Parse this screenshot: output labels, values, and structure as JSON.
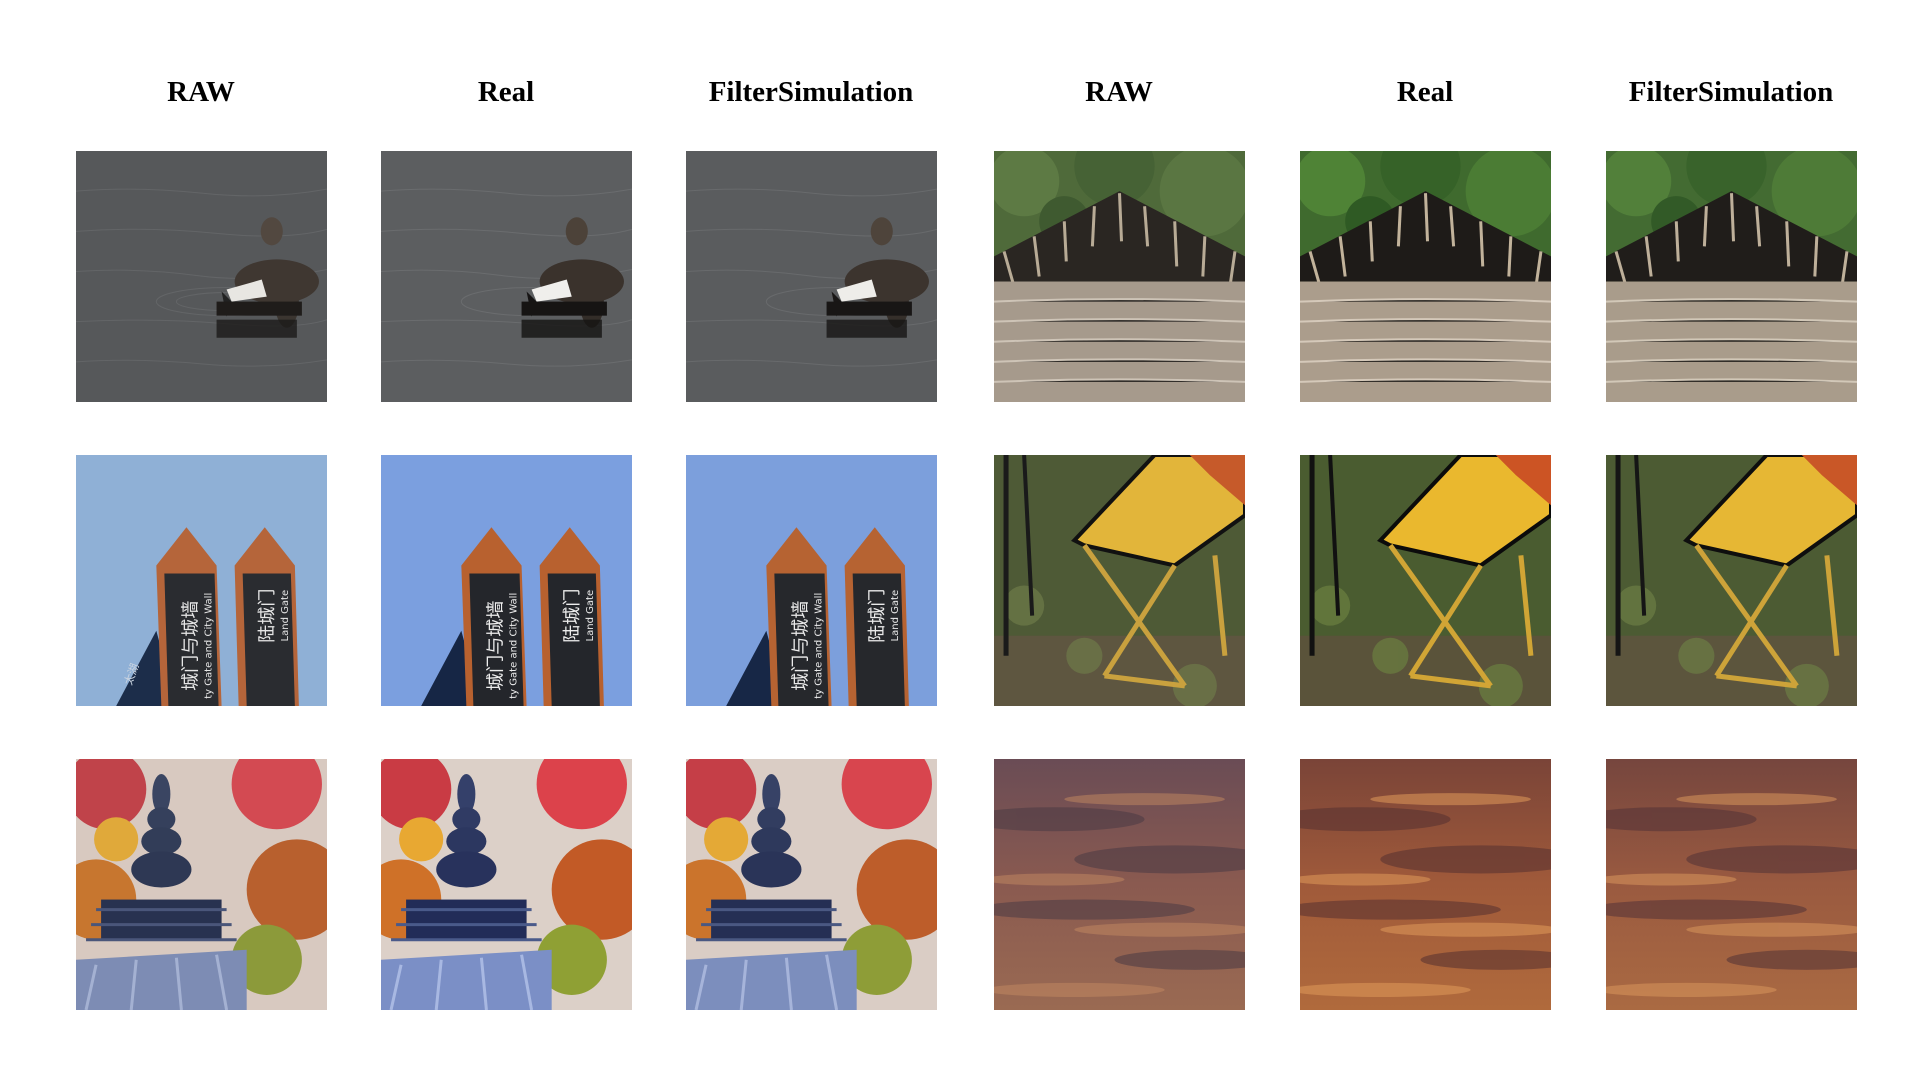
{
  "figure": {
    "columns": [
      "RAW",
      "Real",
      "FilterSimulation",
      "RAW",
      "Real",
      "FilterSimulation"
    ],
    "rows": [
      {
        "scene": "duck",
        "variants": [
          "raw",
          "real",
          "filter"
        ]
      },
      {
        "scene": "hut",
        "variants": [
          "raw",
          "real",
          "filter"
        ]
      },
      {
        "scene": "signposts",
        "variants": [
          "raw",
          "real",
          "filter"
        ]
      },
      {
        "scene": "chairs",
        "variants": [
          "raw",
          "real",
          "filter"
        ]
      },
      {
        "scene": "pagoda",
        "variants": [
          "raw",
          "real",
          "filter"
        ]
      },
      {
        "scene": "sunset-clouds",
        "variants": [
          "raw",
          "real",
          "filter"
        ]
      }
    ],
    "sign_texts": {
      "left_cn": "城门与城墙",
      "left_en": "City Gate and City Wall",
      "left_en_partial": "ty Gate and City Wall",
      "right_cn": "陆城门",
      "right_en": "Land Gate",
      "corner_cn": "太湖"
    }
  }
}
